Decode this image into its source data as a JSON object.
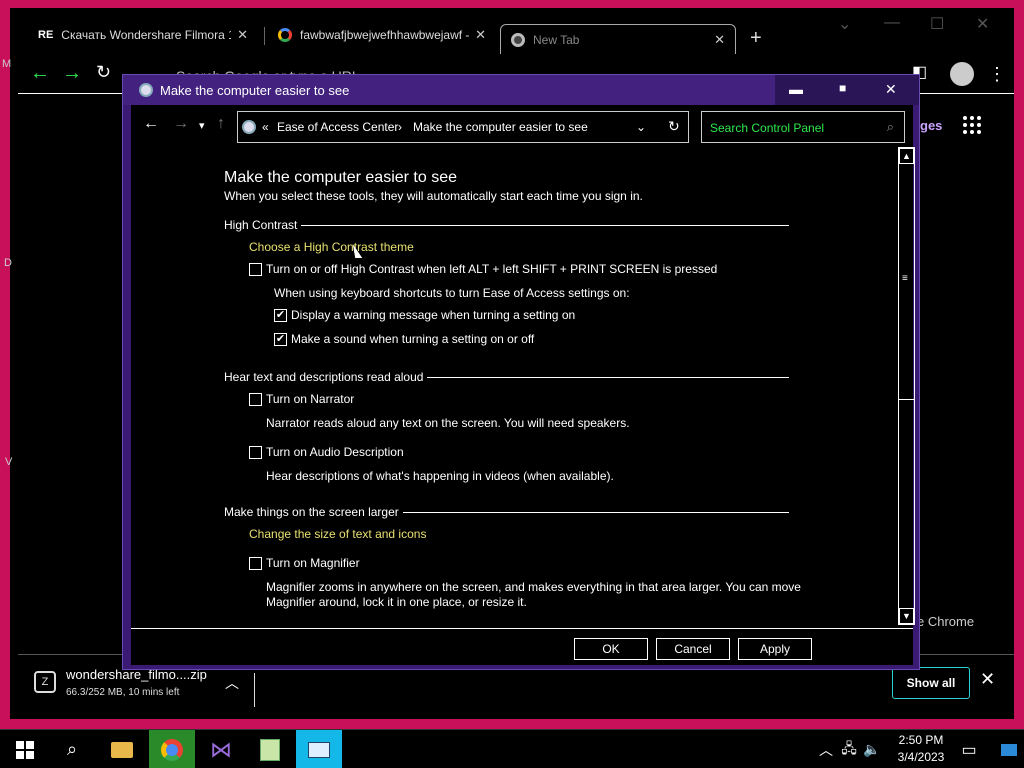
{
  "browser": {
    "tabs": [
      {
        "icon": "RE",
        "title": "Скачать Wondershare Filmora 1..."
      },
      {
        "icon": "G",
        "title": "fawbwafjbwejwefhhawbwejawf -"
      },
      {
        "icon": "chrome",
        "title": "New Tab"
      }
    ],
    "omnibox_text": "Search Google or type a URL",
    "ghost_text_1": "ges",
    "ghost_text_2": "e Chrome",
    "ghost_left_1": "M",
    "ghost_left_2": "D",
    "ghost_left_3": "V"
  },
  "dialog": {
    "title": "Make the computer easier to see",
    "breadcrumb": {
      "prefix": "«",
      "item1": "Ease of Access Center",
      "sep": "›",
      "item2": "Make the computer easier to see"
    },
    "search_placeholder": "Search Control Panel",
    "heading": "Make the computer easier to see",
    "subheading": "When you select these tools, they will automatically start each time you sign in.",
    "sections": {
      "high_contrast": {
        "title": "High Contrast",
        "link": "Choose a High Contrast theme",
        "toggle_label": "Turn on or off High Contrast when left ALT + left SHIFT + PRINT SCREEN is pressed",
        "shortcut_note": "When using keyboard shortcuts to turn Ease of Access settings on:",
        "warning_label": "Display a warning message when turning a setting on",
        "sound_label": "Make a sound when turning a setting on or off"
      },
      "narrator": {
        "title": "Hear text and descriptions read aloud",
        "narrator_label": "Turn on Narrator",
        "narrator_desc": "Narrator reads aloud any text on the screen. You will need speakers.",
        "audio_label": "Turn on Audio Description",
        "audio_desc": "Hear descriptions of what's happening in videos (when available)."
      },
      "larger": {
        "title": "Make things on the screen larger",
        "link": "Change the size of text and icons",
        "magnifier_label": "Turn on Magnifier",
        "magnifier_desc_1": "Magnifier zooms in anywhere on the screen, and makes everything in that area larger. You can move",
        "magnifier_desc_2": "Magnifier around, lock it in one place, or resize it."
      }
    },
    "checkboxes": {
      "high_contrast": false,
      "warning": true,
      "sound": true,
      "narrator": false,
      "audio": false,
      "magnifier": false
    },
    "buttons": {
      "ok": "OK",
      "cancel": "Cancel",
      "apply": "Apply"
    }
  },
  "download": {
    "filename": "wondershare_filmo....zip",
    "status": "66.3/252 MB, 10 mins left",
    "show_all": "Show all"
  },
  "taskbar": {
    "time": "2:50 PM",
    "date": "3/4/2023"
  },
  "colors": {
    "frame": "#c8105a",
    "dialog_title": "#42217f",
    "link": "#e8e070",
    "search_text": "#2ee84c",
    "showall_border": "#2bd2d2"
  }
}
